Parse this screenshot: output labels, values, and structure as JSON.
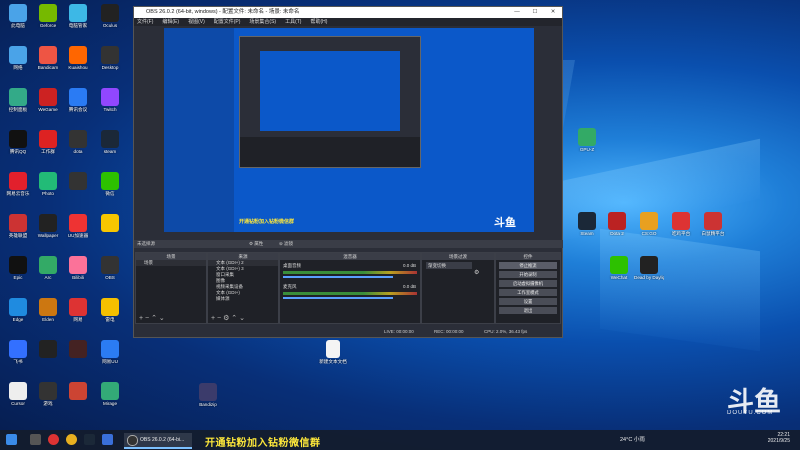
{
  "desktop_icons_left": [
    {
      "label": "此电脑",
      "color": "#4aa3e8"
    },
    {
      "label": "Geforce",
      "color": "#76b900"
    },
    {
      "label": "电脑管家",
      "color": "#3db8e6"
    },
    {
      "label": "Oculus",
      "color": "#222"
    },
    {
      "label": "网络",
      "color": "#4aa3e8"
    },
    {
      "label": "Bandicam",
      "color": "#e54"
    },
    {
      "label": "Kuaishou",
      "color": "#f60"
    },
    {
      "label": "Desktop",
      "color": "#333"
    },
    {
      "label": "控制面板",
      "color": "#3a8"
    },
    {
      "label": "WeGame",
      "color": "#c22"
    },
    {
      "label": "腾讯会议",
      "color": "#2a7bf4"
    },
    {
      "label": "Twitch",
      "color": "#9147ff"
    },
    {
      "label": "腾讯QQ",
      "color": "#111"
    },
    {
      "label": "工作群",
      "color": "#d22"
    },
    {
      "label": "dota",
      "color": "#333"
    },
    {
      "label": "steam",
      "color": "#1b2838"
    },
    {
      "label": "网易云音乐",
      "color": "#e2202c"
    },
    {
      "label": "Photo",
      "color": "#2b7"
    },
    {
      "label": "",
      "color": "#333"
    },
    {
      "label": "微信",
      "color": "#2dc100"
    },
    {
      "label": "英雄联盟",
      "color": "#c33"
    },
    {
      "label": "Wallpaper",
      "color": "#222"
    },
    {
      "label": "UU加速器",
      "color": "#e33"
    },
    {
      "label": "",
      "color": "#f7c600"
    },
    {
      "label": "Epic",
      "color": "#111"
    },
    {
      "label": "Arc",
      "color": "#3a6"
    },
    {
      "label": "Bilibili",
      "color": "#fb7299"
    },
    {
      "label": "OBS",
      "color": "#333"
    },
    {
      "label": "Edge",
      "color": "#1f8be0"
    },
    {
      "label": "Elden",
      "color": "#c71"
    },
    {
      "label": "网易",
      "color": "#d33"
    },
    {
      "label": "雷电",
      "color": "#f5c000"
    },
    {
      "label": "飞书",
      "color": "#3370ff"
    },
    {
      "label": "",
      "color": "#222"
    },
    {
      "label": "",
      "color": "#422"
    },
    {
      "label": "网易UU",
      "color": "#2b7cf3"
    },
    {
      "label": "Cursor",
      "color": "#eee"
    },
    {
      "label": "游戏",
      "color": "#333"
    },
    {
      "label": "",
      "color": "#c43"
    },
    {
      "label": "Mirage",
      "color": "#3a7"
    }
  ],
  "desktop_icons_right": [
    {
      "label": "Steam",
      "color": "#1b2838"
    },
    {
      "label": "Dota 2",
      "color": "#b22"
    },
    {
      "label": "CS:GO",
      "color": "#e8a020"
    },
    {
      "label": "吃鸡平台",
      "color": "#d33"
    },
    {
      "label": "白鼠精平台",
      "color": "#c33"
    },
    {
      "label": "GPU-Z",
      "color": "#3a6"
    },
    {
      "label": "Dead by Daylight",
      "color": "#222"
    },
    {
      "label": "WeChat",
      "color": "#2dc100"
    }
  ],
  "desktop_file": {
    "label": "新建文本文档"
  },
  "desktop_misc": {
    "label": "Bandizip"
  },
  "obs": {
    "title": "OBS 26.0.2 (64-bit, windows) - 配置文件: 未命名 - 场景: 未命名",
    "menu": [
      "文件(F)",
      "编辑(E)",
      "视图(V)",
      "配置文件(P)",
      "场景集合(S)",
      "工具(T)",
      "帮助(H)"
    ],
    "scene_bar_label": "未选择源",
    "panels": {
      "scenes": {
        "title": "场景",
        "items": [
          "场景"
        ]
      },
      "sources": {
        "title": "来源",
        "items": [
          "文本 (GDI+) 2",
          "文本 (GDI+) 3",
          "窗口采集",
          "图像",
          "视频采集设备",
          "文本 (GDI+)",
          "媒体源"
        ]
      },
      "mixer": {
        "title": "混音器",
        "tracks": [
          "桌面音频",
          "麦克风"
        ],
        "levels": [
          "0.0 dB",
          "0.0 dB"
        ]
      },
      "transitions": {
        "title": "场景过渡",
        "value": "渐变切换"
      },
      "controls": {
        "title": "控件",
        "buttons": [
          "停止推流",
          "开始录制",
          "启动虚拟摄像机",
          "工作室模式",
          "设置",
          "退出"
        ]
      }
    },
    "status": {
      "live": "LIVE: 00:00:00",
      "rec": "REC: 00:00:00",
      "cpu": "CPU: 2.0%, 36.43 fps"
    },
    "preview_caption": "开通钻粉加入钻粉微信群",
    "preview_brand": "斗鱼"
  },
  "taskbar": {
    "obs_item": "OBS 26.0.2 (64-bi...",
    "weather": "24°C 小雨",
    "time": "22:21",
    "date": "2021/9/25",
    "subtitle": "开通钻粉加入钻粉微信群"
  },
  "watermark": {
    "brand": "斗鱼",
    "url": "DOUYU.COM"
  }
}
